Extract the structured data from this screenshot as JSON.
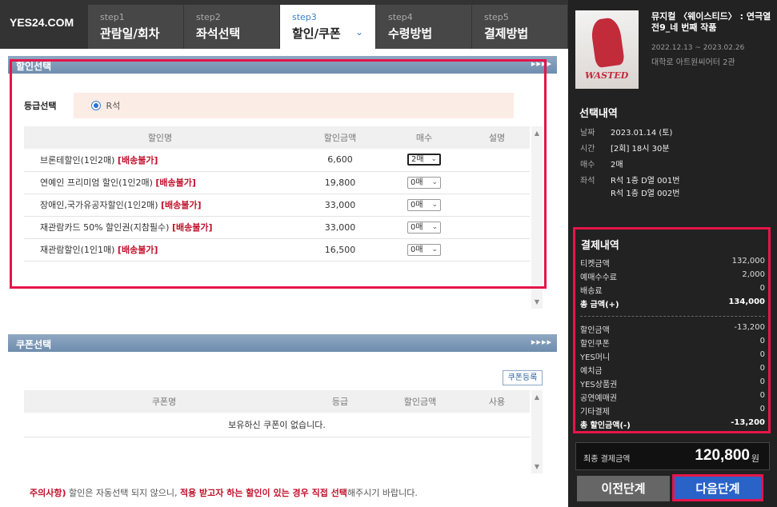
{
  "header": {
    "logo": "YES24.COM",
    "steps": [
      {
        "num": "step1",
        "label": "관람일/회차"
      },
      {
        "num": "step2",
        "label": "좌석선택"
      },
      {
        "num": "step3",
        "label": "할인/쿠폰"
      },
      {
        "num": "step4",
        "label": "수령방법"
      },
      {
        "num": "step5",
        "label": "결제방법"
      }
    ],
    "active_step": 2
  },
  "discount": {
    "title": "할인선택",
    "grade_label": "등급선택",
    "grade_option": "R석",
    "columns": [
      "할인명",
      "할인금액",
      "매수",
      "설명"
    ],
    "rows": [
      {
        "name": "브론테할인(1인2매)",
        "tag": "[배송불가]",
        "amount": "6,600",
        "qty": "2매"
      },
      {
        "name": "연예인 프리미엄 할인(1인2매)",
        "tag": "[배송불가]",
        "amount": "19,800",
        "qty": "0매"
      },
      {
        "name": "장애인,국가유공자할인(1인2매)",
        "tag": "[배송불가]",
        "amount": "33,000",
        "qty": "0매"
      },
      {
        "name": "재관람카드 50% 할인권(지참필수)",
        "tag": "[배송불가]",
        "amount": "33,000",
        "qty": "0매"
      },
      {
        "name": "재관람할인(1인1매)",
        "tag": "[배송불가]",
        "amount": "16,500",
        "qty": "0매"
      }
    ]
  },
  "coupon": {
    "title": "쿠폰선택",
    "register_label": "쿠폰등록",
    "columns": [
      "쿠폰명",
      "등급",
      "할인금액",
      "사용"
    ],
    "empty_message": "보유하신 쿠폰이 없습니다."
  },
  "notice": {
    "prefix": "주의사항)",
    "text1": " 할인은 자동선택 되지 않으니, ",
    "emphasis": "적용 받고자 하는 할인이 있는 경우 직접 선택",
    "text2": "해주시기 바랍니다."
  },
  "show": {
    "poster_title": "WASTED",
    "title": "뮤지컬 〈웨이스티드〉 : 연극열전9_네 번째 작품",
    "date_range": "2022.12.13 ~ 2023.02.26",
    "venue": "대학로 아트원씨어터 2관"
  },
  "selection": {
    "title": "선택내역",
    "date_label": "날짜",
    "date_value": "2023.01.14 (토)",
    "time_label": "시간",
    "time_value": "[2회] 18시 30분",
    "qty_label": "매수",
    "qty_value": "2매",
    "seat_label": "좌석",
    "seat_value1": "R석 1층 D열 001번",
    "seat_value2": "R석 1층 D열 002번"
  },
  "payment": {
    "title": "결제내역",
    "rows": [
      {
        "label": "티켓금액",
        "value": "132,000"
      },
      {
        "label": "예매수수료",
        "value": "2,000"
      },
      {
        "label": "배송료",
        "value": "0"
      },
      {
        "label": "총 금액(+)",
        "value": "134,000"
      },
      {
        "label": "할인금액",
        "value": "-13,200"
      },
      {
        "label": "할인쿠폰",
        "value": "0"
      },
      {
        "label": "YES머니",
        "value": "0"
      },
      {
        "label": "예치금",
        "value": "0"
      },
      {
        "label": "YES상품권",
        "value": "0"
      },
      {
        "label": "공연예매권",
        "value": "0"
      },
      {
        "label": "기타결제",
        "value": "0"
      },
      {
        "label": "총 할인금액(-)",
        "value": "-13,200"
      }
    ],
    "final_label": "최종 결제금액",
    "final_value": "120,800",
    "final_unit": "원"
  },
  "buttons": {
    "prev": "이전단계",
    "next": "다음단계"
  }
}
